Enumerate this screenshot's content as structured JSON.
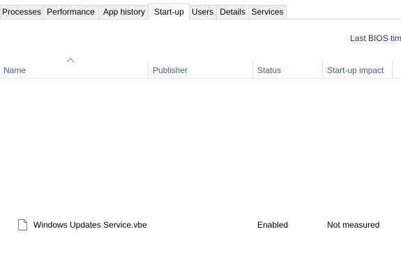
{
  "tabs": [
    {
      "label": "Processes",
      "active": false
    },
    {
      "label": "Performance",
      "active": false
    },
    {
      "label": "App history",
      "active": false
    },
    {
      "label": "Start-up",
      "active": true
    },
    {
      "label": "Users",
      "active": false
    },
    {
      "label": "Details",
      "active": false
    },
    {
      "label": "Services",
      "active": false
    }
  ],
  "bios_label": "Last BIOS time",
  "columns": {
    "name": "Name",
    "publisher": "Publisher",
    "status": "Status",
    "impact": "Start-up impact"
  },
  "sort": {
    "column": "name",
    "direction": "ascending",
    "icon": "sort-up-icon"
  },
  "rows": [
    {
      "icon": "file-icon",
      "name": "Windows Updates Service.vbe",
      "publisher": "",
      "status": "Enabled",
      "impact": "Not measured"
    }
  ],
  "colors": {
    "header_text": "#4c607a",
    "link_text": "#1e395b",
    "tab_border": "#dadada",
    "tab_inactive_bg": "#f0f0f0"
  }
}
